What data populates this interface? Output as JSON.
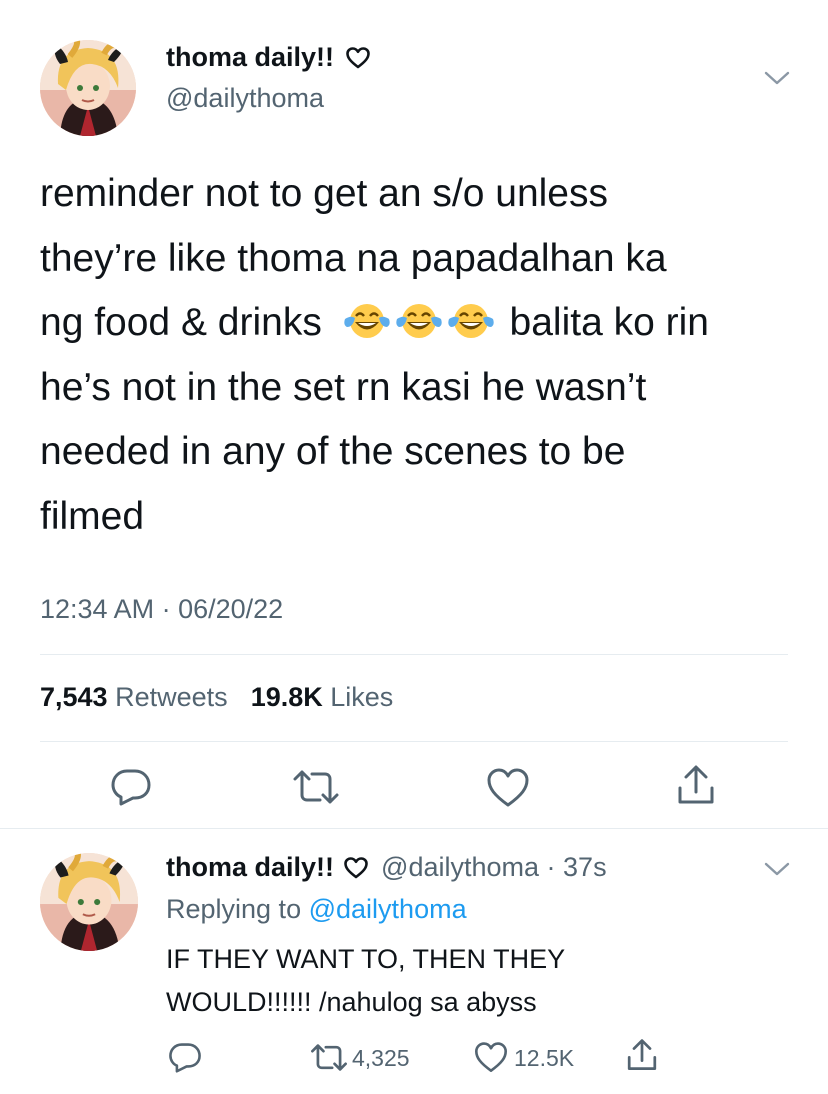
{
  "tweet": {
    "author_name": "thoma daily!!",
    "author_handle": "@dailythoma",
    "text_line1": "reminder not to get an s/o unless",
    "text_line2": "they’re like thoma na papadalhan ka",
    "text_line3a": "ng food & drinks",
    "emojis": [
      "face-with-tears-of-joy",
      "face-with-tears-of-joy",
      "face-with-tears-of-joy"
    ],
    "text_line3b": "balita ko rin",
    "text_line4": "he’s not in the set rn kasi he wasn’t",
    "text_line5": "needed in any of the scenes to be",
    "text_line6": "filmed",
    "timestamp": "12:34 AM · 06/20/22",
    "retweets_count": "7,543",
    "retweets_label": "Retweets",
    "likes_count": "19.8K",
    "likes_label": "Likes"
  },
  "reply": {
    "author_name": "thoma daily!!",
    "author_handle": "@dailythoma",
    "time": "· 37s",
    "replying_prefix": "Replying to",
    "replying_handle": "@dailythoma",
    "text_line1": "IF THEY WANT TO, THEN THEY",
    "text_line2": "WOULD!!!!!! /nahulog sa abyss",
    "retweets_count": "4,325",
    "likes_count": "12.5K"
  },
  "icons": {
    "heart_badge": "heart-outline-icon",
    "chevron": "chevron-down-icon",
    "reply": "reply-icon",
    "retweet": "retweet-icon",
    "like": "heart-icon",
    "share": "share-icon"
  },
  "colors": {
    "text": "#0f1419",
    "secondary": "#536471",
    "link": "#1d9bf0",
    "divider": "#e6ecf0",
    "emoji": "#ffcc4d"
  }
}
